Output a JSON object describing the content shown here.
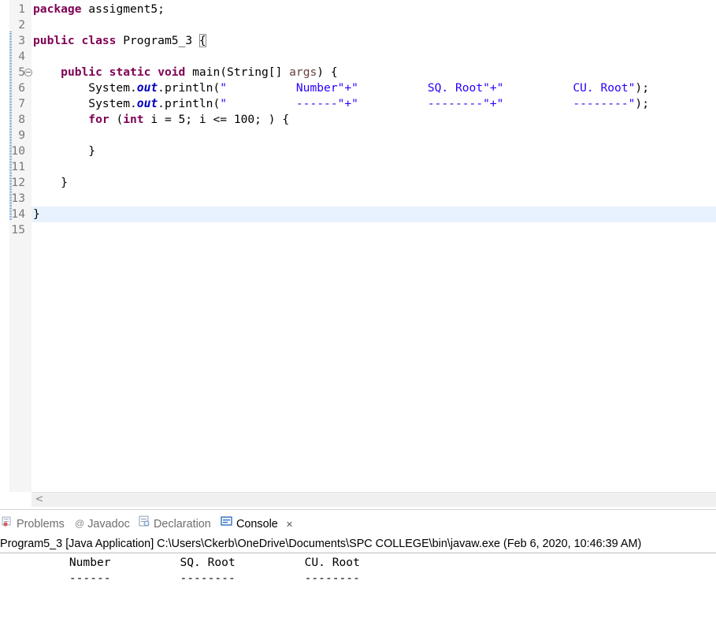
{
  "editor": {
    "line_numbers": [
      "1",
      "2",
      "3",
      "4",
      "5",
      "6",
      "7",
      "8",
      "9",
      "10",
      "11",
      "12",
      "13",
      "14",
      "15"
    ],
    "lines": [
      [
        {
          "t": "package",
          "s": "kw"
        },
        {
          "t": " assigment5;"
        }
      ],
      [],
      [
        {
          "t": "public",
          "s": "kw"
        },
        {
          "t": " "
        },
        {
          "t": "class",
          "s": "kw"
        },
        {
          "t": " Program5_3 "
        },
        {
          "t": "{",
          "s": "brace-hl"
        }
      ],
      [],
      [
        {
          "t": "    "
        },
        {
          "t": "public",
          "s": "kw"
        },
        {
          "t": " "
        },
        {
          "t": "static",
          "s": "kw"
        },
        {
          "t": " "
        },
        {
          "t": "void",
          "s": "kw"
        },
        {
          "t": " main(String[] "
        },
        {
          "t": "args",
          "s": "prm"
        },
        {
          "t": ") {"
        }
      ],
      [
        {
          "t": "        System."
        },
        {
          "t": "out",
          "s": "fld"
        },
        {
          "t": ".println("
        },
        {
          "t": "\"          Number\"+\"          SQ. Root\"+\"          CU. Root\"",
          "s": "str"
        },
        {
          "t": ");"
        }
      ],
      [
        {
          "t": "        System."
        },
        {
          "t": "out",
          "s": "fld"
        },
        {
          "t": ".println("
        },
        {
          "t": "\"          ------\"+\"          --------\"+\"          --------\"",
          "s": "str"
        },
        {
          "t": ");"
        }
      ],
      [
        {
          "t": "        "
        },
        {
          "t": "for",
          "s": "kw"
        },
        {
          "t": " ("
        },
        {
          "t": "int",
          "s": "kw"
        },
        {
          "t": " i = 5; i <= 100; ) {"
        }
      ],
      [],
      [
        {
          "t": "        }"
        }
      ],
      [],
      [
        {
          "t": "    }"
        }
      ],
      [],
      [
        {
          "t": "}"
        }
      ],
      []
    ],
    "hscroll_left_glyph": "<"
  },
  "tabs": [
    {
      "label": "Problems",
      "icon": "problems-icon",
      "active": false
    },
    {
      "label": "Javadoc",
      "icon": "javadoc-at-icon",
      "glyph": "@",
      "active": false
    },
    {
      "label": "Declaration",
      "icon": "declaration-icon",
      "active": false
    },
    {
      "label": "Console",
      "icon": "console-icon",
      "active": true,
      "close": "✕"
    }
  ],
  "console": {
    "header": "Program5_3 [Java Application] C:\\Users\\Ckerb\\OneDrive\\Documents\\SPC COLLEGE\\bin\\javaw.exe (Feb 6, 2020, 10:46:39 AM)",
    "output": [
      "          Number          SQ. Root          CU. Root",
      "          ------          --------          --------"
    ]
  },
  "colors": {
    "keyword": "#7f0055",
    "string": "#2a00ff",
    "static_field": "#0000c0",
    "parameter": "#6a3e3e",
    "current_line": "#e8f2fe",
    "gutter": "#f5f5f5"
  }
}
